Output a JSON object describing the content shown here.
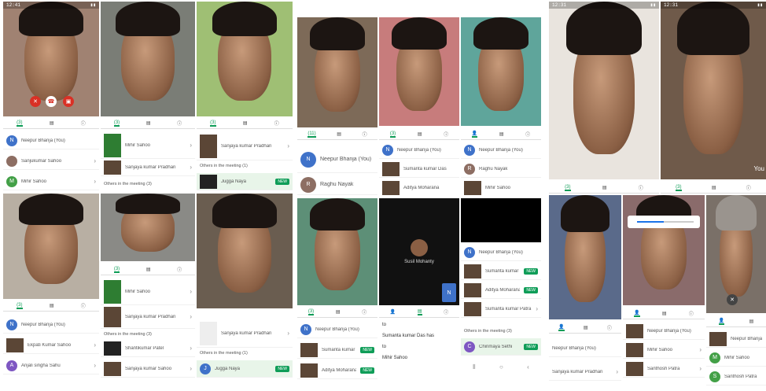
{
  "collage": {
    "p1": {
      "status_time": "12:41",
      "tabs": [
        "(3)",
        "",
        "ⓘ"
      ],
      "rows": [
        {
          "avatar": "N",
          "name": "Neepur Bhanja (You)"
        },
        {
          "avatar": "",
          "name": "Sanjukumar Sahoo"
        },
        {
          "avatar": "M",
          "name": "Mihir Sahoo"
        }
      ]
    },
    "p2": {
      "tabs": [
        "(3)",
        "",
        ""
      ],
      "rows": [
        {
          "name": "Mihir Sahoo"
        },
        {
          "name": "Sanjaya kumar Pradhan"
        }
      ],
      "section": "Others in the meeting (3)"
    },
    "p3": {
      "tabs": [
        "(3)",
        "",
        ""
      ],
      "rows": [
        {
          "name": "Sanjaya kumar Pradhan"
        }
      ],
      "section": "Others in the meeting (1)",
      "waiting": {
        "name": "Jugga Naya",
        "badge": "NEW"
      }
    },
    "p4": {
      "tabs": [
        "(3)",
        "",
        ""
      ],
      "rows": [
        {
          "avatar": "N",
          "name": "Neepur Bhanja (You)"
        },
        {
          "name": "Ekpati Kumar Sahoo"
        },
        {
          "avatar": "A",
          "name": "Anjali singha Sahu"
        }
      ]
    },
    "p5": {
      "tabs": [
        "(3)",
        "",
        ""
      ],
      "rows": [
        {
          "name": "Mihir Sahoo"
        },
        {
          "name": "Sanjaya kumar Pradhan"
        }
      ],
      "section": "Others in the meeting (3)",
      "rows2": [
        {
          "name": "Shantikumar Patel"
        },
        {
          "name": "Sanjaya kumar Sahoo"
        }
      ]
    },
    "p6": {
      "rows": [
        {
          "name": "Sanjaya kumar Pradhan"
        }
      ],
      "section": "Others in the meeting (1)",
      "waiting": {
        "avatar": "J",
        "name": "Jugga Naya",
        "badge": "NEW"
      }
    },
    "p7": {
      "tabs": [
        "(11)",
        "",
        ""
      ],
      "rows": [
        {
          "avatar": "N",
          "name": "Neepur Bhanja (You)"
        },
        {
          "avatar": "R",
          "name": "Raghu Nayak"
        }
      ]
    },
    "p8": {
      "tabs": [
        "(3)",
        "",
        ""
      ],
      "rows": [
        {
          "avatar": "N",
          "name": "Neepur Bhanja (You)"
        },
        {
          "name": "Sumanta kumar Das"
        },
        {
          "name": "Aditya Moharana"
        }
      ]
    },
    "p9": {
      "tabs": [
        "",
        "",
        ""
      ],
      "rows": [
        {
          "avatar": "N",
          "name": "Neepur Bhanja (You)"
        },
        {
          "avatar": "R",
          "name": "Raghu Nayak"
        },
        {
          "name": "Mihir Sahoo"
        }
      ]
    },
    "p10": {
      "tabs": [
        "(3)",
        "",
        ""
      ],
      "rows": [
        {
          "avatar": "N",
          "name": "Neepur Bhanja (You)"
        },
        {
          "name": "Sumanta kumar Das",
          "badge": "NEW"
        },
        {
          "name": "Aditya Moharana",
          "badge": "NEW"
        }
      ]
    },
    "p11": {
      "tile": "Susil Mohanty",
      "tabs": [
        "",
        "",
        ""
      ],
      "lines": [
        "to",
        "Sumanta kumar Das has",
        "to",
        "Mihir Sahoo"
      ]
    },
    "p12": {
      "rows": [
        {
          "avatar": "N",
          "name": "Neepur Bhanja (You)"
        },
        {
          "name": "Sumanta kumar Das",
          "badge": "NEW"
        },
        {
          "name": "Aditya Moharana",
          "badge": "NEW"
        },
        {
          "name": "Sumanta kumar Patra"
        }
      ],
      "section": "Others in the meeting (3)",
      "waiting": {
        "avatar": "C",
        "name": "Chinmaya Sethi",
        "badge": "NEW"
      }
    },
    "p13": {
      "status_time": "12:31",
      "tabs": [
        "(3)",
        "",
        ""
      ]
    },
    "p14": {
      "status_time": "12:31",
      "tabs": [
        "(3)",
        "",
        ""
      ],
      "badge": "You"
    },
    "p15": {
      "tabs": [
        "",
        "",
        ""
      ],
      "rows": [
        {
          "name": "Neepur Bhanja (You)"
        },
        {
          "name": "Sanjaya kumar Pradhan"
        }
      ]
    },
    "p16": {
      "tabs": [
        "",
        "",
        ""
      ],
      "rows": [
        {
          "name": "Neepur Bhanja (You)"
        },
        {
          "name": "Mihir Sahoo"
        },
        {
          "name": "Santhosh Patra"
        }
      ]
    },
    "p17": {
      "tabs": [
        "",
        "",
        ""
      ],
      "rows": [
        {
          "name": "Neepur Bhanja (You)"
        },
        {
          "avatar": "M",
          "name": "Mihir Sahoo"
        },
        {
          "avatar": "S",
          "name": "Santhosh Patra"
        }
      ]
    }
  },
  "colors": {
    "accent": "#0f9d58",
    "avatar_blue": "#3f72c9",
    "end_call": "#d93025"
  },
  "icons": [
    "people-icon",
    "chat-icon",
    "info-icon",
    "mic-off-icon",
    "hangup-icon",
    "camera-off-icon",
    "chevron-right-icon"
  ]
}
